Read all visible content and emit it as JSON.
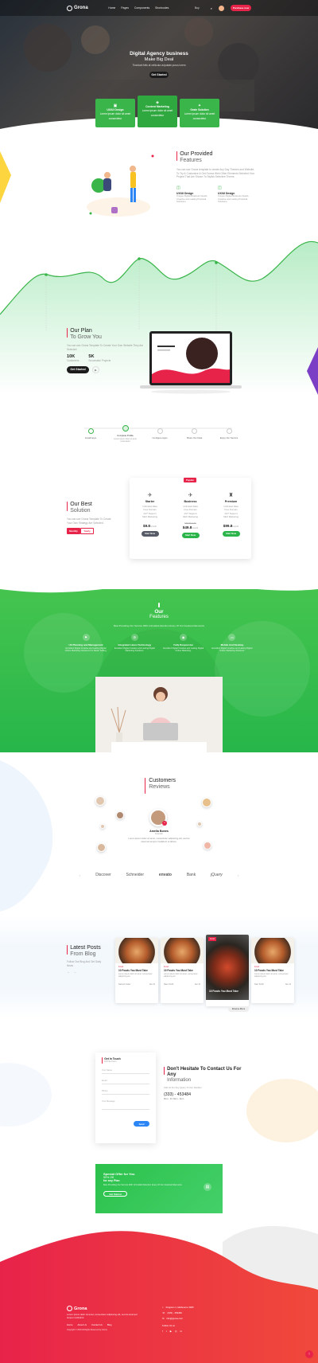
{
  "nav": {
    "logo": "Grona",
    "items": [
      "Home",
      "Pages",
      "Components",
      "Shortcodes"
    ],
    "cart": "Buy",
    "cta": "Purchase now"
  },
  "hero": {
    "title": "Digital Agency business",
    "subtitle": "Make Big Deal",
    "text": "Tincidunt felis at vehicula vulputate purus lorem",
    "button": "Get Started"
  },
  "hero_cards": [
    {
      "title": "UX/UI Design",
      "text": "Lorem ipsum dolor sit amet consectetur"
    },
    {
      "title": "Content Marketing",
      "text": "Lorem ipsum dolor sit amet consectetur"
    },
    {
      "title": "Grate Solution",
      "text": "Lorem ipsum dolor sit amet consectetur"
    }
  ],
  "features": {
    "title": "Our Provided",
    "subtitle": "Features",
    "text": "You can use Grona template to create Any Day Themes and Website. To Try & Customize & Get Gonna Web Other Elements Selected Your Project That Are Shown To Stylish Selective Theme.",
    "items": [
      {
        "title": "UX/UI Design",
        "text": "Unique Digital Business Needs, Creative and Lasting Practical Solutions."
      },
      {
        "title": "UX/UI Design",
        "text": "Unique Digital Business Needs, Creative and Lasting Practical Solutions."
      }
    ]
  },
  "plan": {
    "title": "Our Plan",
    "subtitle": "To Grow You",
    "text": "You can use Grona Template To Create Your Own Website They Are Selected",
    "stats": [
      {
        "value": "10K",
        "label": "Customers"
      },
      {
        "value": "5K",
        "label": "Successful Projects"
      }
    ],
    "button": "Get Started"
  },
  "steps": [
    {
      "label": "Install Apps"
    },
    {
      "label": "Complete Profile",
      "sub": "Lorem ipsum dolor sit amet consectetur"
    },
    {
      "label": "Configure Apps"
    },
    {
      "label": "Share Our Data"
    },
    {
      "label": "Enjoy Our Service"
    }
  ],
  "pricing": {
    "title": "Our Best",
    "subtitle": "Solution",
    "text": "You can use Grona Template To Create Your Own Strategy Are Selected.",
    "tabs": [
      "Monthly",
      "Yearly"
    ],
    "badge": "Popular",
    "plans": [
      {
        "name": "Starter",
        "icon": "paper-plane-icon",
        "features": [
          "Unlimited Data",
          "Free Domain",
          "24/7 Support",
          "SEO Marketing"
        ],
        "price": "$9.8",
        "per": "/month",
        "button": "Start Now",
        "btn_color": "#555a66"
      },
      {
        "name": "Business",
        "icon": "airplane-icon",
        "features": [
          "Unlimited Data",
          "Free Domain",
          "24/7 Support",
          "SEO Marketing"
        ],
        "price": "$49.8",
        "per": "/month",
        "button": "Start Now",
        "btn_color": "#2bb44a",
        "old": "$79.8/month"
      },
      {
        "name": "Premium",
        "icon": "rocket-icon",
        "features": [
          "Unlimited Data",
          "Free Domain",
          "24/7 Support",
          "SEO Marketing"
        ],
        "price": "$99.8",
        "per": "/month",
        "button": "Start Now",
        "btn_color": "#2bb44a"
      }
    ]
  },
  "our_features": {
    "title": "Our",
    "subtitle": "Features",
    "text": "Best Providing Our Service With Unrivalled Attention Every Of Our Featured Elements",
    "items": [
      {
        "title": "UX Planning and Management",
        "text": "Excellent Digital Creative and Lasting Digital Online Marketing Solutions For Better Selling."
      },
      {
        "title": "Integrated Latest Technology",
        "text": "Excellent Digital Creative and Lasting Digital Marketing Solutions."
      },
      {
        "title": "Fully Responsive",
        "text": "Excellent Digital Creative and Lasting Digital Online Marketing."
      },
      {
        "title": "Mobile And Desktop",
        "text": "Excellent Digital Creative and Lasting Digital Online Marketing Solutions."
      }
    ]
  },
  "reviews": {
    "title": "Customers",
    "subtitle": "Reviews",
    "name": "Amelia Bones",
    "role": "Founder",
    "text": "Lorem ipsum dolor sit amet, consectetur adipiscing elit, sed do eiusmod tempor incididunt ut labore."
  },
  "logos": [
    "Discover",
    "Schneider",
    "envato",
    "Bank",
    "jQuery"
  ],
  "blog": {
    "title": "Latest Posts",
    "subtitle": "From Blog",
    "text": "Follow Our Blog And Get Daily News",
    "button": "Browse More",
    "posts": [
      {
        "cat": "Food",
        "title": "10 Foods You Must Take",
        "desc": "Lorem ipsum dolor sit amet, consectetur adipiscing elit.",
        "author": "Samuel Carter",
        "date": "Jan 12"
      },
      {
        "cat": "Food",
        "title": "10 Foods You Must Take",
        "desc": "Lorem ipsum dolor sit amet, consectetur adipiscing elit.",
        "author": "Dave Smith",
        "date": "Jan 12"
      },
      {
        "cat": "Food",
        "title": "10 Foods You Must Take",
        "desc": "Lorem ipsum dolor sit amet, consectetur adipiscing elit.",
        "author": "Dave Smith",
        "date": "Jan 12"
      },
      {
        "cat": "Food",
        "title": "10 Foods You Must Take",
        "desc": "Lorem ipsum dolor sit amet, consectetur adipiscing elit.",
        "author": "Sam Smith",
        "date": "Jan 12"
      }
    ]
  },
  "contact": {
    "form_title": "Get In Touch",
    "form_sub": "Fill The Form",
    "fields": [
      "Your Name",
      "Email",
      "Phone",
      "Your Message"
    ],
    "button": "Send",
    "title": "Don't Hesitate To Contact Us For Any",
    "subtitle": "Information",
    "text": "Call Us For Any Query To Our Number",
    "phone": "(333) - 453484",
    "hours": "Mon - Fri 9am - 6pm"
  },
  "offer": {
    "title": "Special Offer for You",
    "l2": "50% Off",
    "l3": "for any Plan",
    "text": "Best Providing Our Service With Unrivalled Attention Every Of Our Featured Elements.",
    "button": "Get Started"
  },
  "footer": {
    "logo": "Grona",
    "text": "Lorem ipsum dolor sit amet, consectetur adipiscing elit, sed do eiusmod tempor incididunt.",
    "links": [
      "Home",
      "About Us",
      "Contact Us",
      "Blog"
    ],
    "copyright": "Copyright © 2019 All Rights Reserved by Grona",
    "address": "Kingston 1, Melbourne 3005",
    "phone": "(333) - 453484",
    "email": "info@grona.com",
    "follow": "Follow Us on"
  }
}
